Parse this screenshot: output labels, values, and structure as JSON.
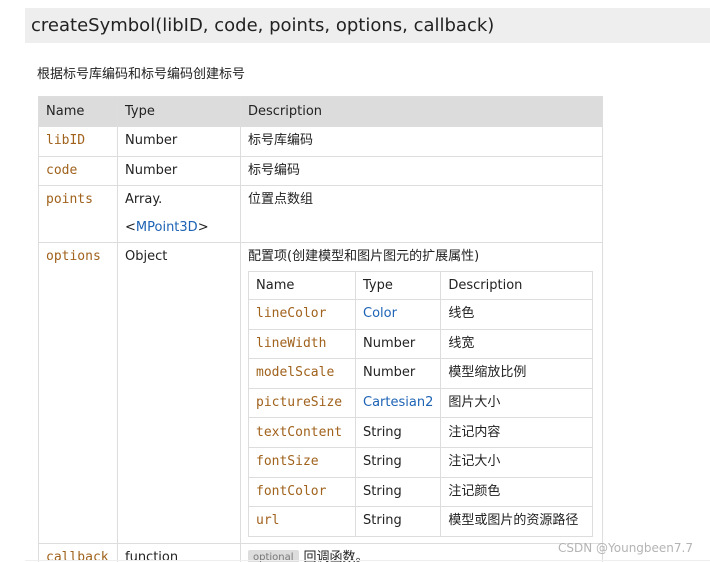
{
  "method": {
    "signature": "createSymbol(libID, code, points, options, callback)",
    "description": "根据标号库编码和标号编码创建标号"
  },
  "params_table": {
    "headers": [
      "Name",
      "Type",
      "Description"
    ],
    "rows": [
      {
        "name": "libID",
        "type": "Number",
        "description": "标号库编码"
      },
      {
        "name": "code",
        "type": "Number",
        "description": "标号编码"
      },
      {
        "name": "points",
        "type_prefix": "Array.<",
        "type_link": "MPoint3D",
        "type_suffix": ">",
        "description": "位置点数组"
      },
      {
        "name": "options",
        "type": "Object",
        "description": "配置项(创建模型和图片图元的扩展属性)"
      },
      {
        "name": "callback",
        "type": "function",
        "badge": "optional",
        "description": "回调函数。"
      }
    ]
  },
  "options_table": {
    "headers": [
      "Name",
      "Type",
      "Description"
    ],
    "rows": [
      {
        "name": "lineColor",
        "type": "Color",
        "description": "线色"
      },
      {
        "name": "lineWidth",
        "type": "Number",
        "description": "线宽"
      },
      {
        "name": "modelScale",
        "type": "Number",
        "description": "模型缩放比例"
      },
      {
        "name": "pictureSize",
        "type": "Cartesian2",
        "description": "图片大小"
      },
      {
        "name": "textContent",
        "type": "String",
        "description": "注记内容"
      },
      {
        "name": "fontSize",
        "type": "String",
        "description": "注记大小"
      },
      {
        "name": "fontColor",
        "type": "String",
        "description": "注记颜色"
      },
      {
        "name": "url",
        "type": "String",
        "description": "模型或图片的资源路径"
      }
    ]
  },
  "watermark": "CSDN @Youngbeen7.7",
  "colors": {
    "param_name": "#a0621c",
    "type_link": "#1d63b5",
    "header_bg": "#dcdcdc",
    "title_bg": "#eeeeee"
  }
}
